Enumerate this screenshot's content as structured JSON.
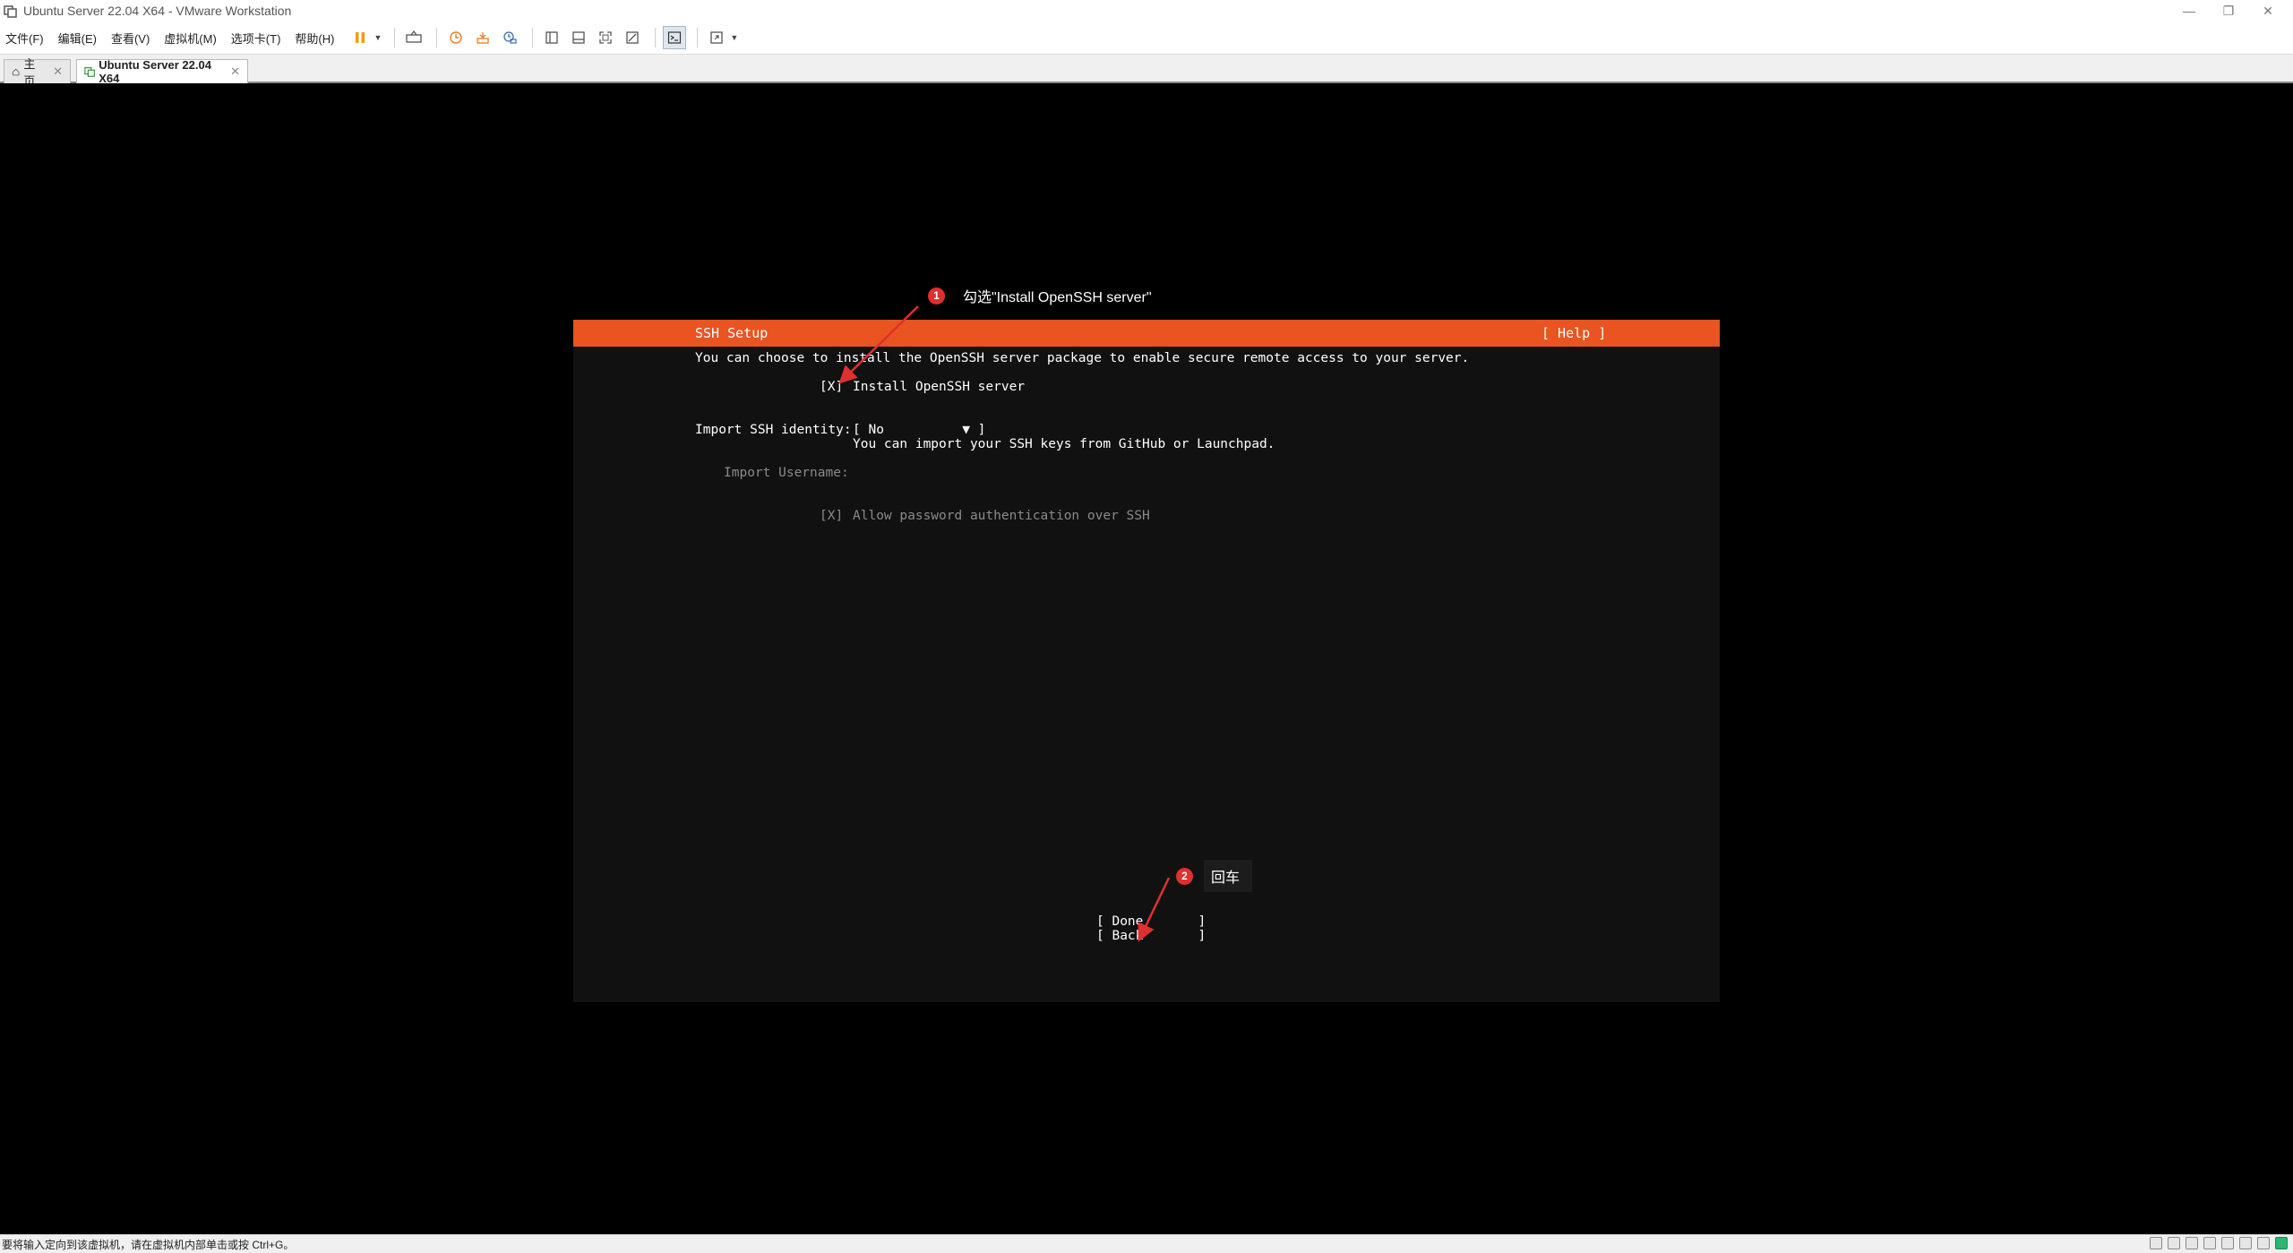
{
  "window": {
    "title": "Ubuntu Server 22.04 X64 - VMware Workstation",
    "minimize": "—",
    "restore": "❐",
    "close": "✕"
  },
  "menu": [
    "文件(F)",
    "编辑(E)",
    "查看(V)",
    "虚拟机(M)",
    "选项卡(T)",
    "帮助(H)"
  ],
  "tabs": [
    {
      "label": "主页",
      "close": "✕"
    },
    {
      "label": "Ubuntu Server 22.04 X64",
      "close": "✕"
    }
  ],
  "installer": {
    "header_title": "SSH Setup",
    "help": "[ Help ]",
    "intro": "You can choose to install the OpenSSH server package to enable secure remote access to your server.",
    "install_ssh_checkbox": "[X]",
    "install_ssh_label": "Install OpenSSH server",
    "import_identity_label": "Import SSH identity:",
    "import_identity_select": "[ No          ▼ ]",
    "import_identity_help": "You can import your SSH keys from GitHub or Launchpad.",
    "import_username_label": "Import Username:",
    "allow_password_checkbox": "[X]",
    "allow_password_label": "Allow password authentication over SSH",
    "done_button": "[ Done       ]",
    "back_button": "[ Back       ]"
  },
  "annotations": [
    {
      "number": "1",
      "text": "勾选\"Install OpenSSH server\""
    },
    {
      "number": "2",
      "text": "回车"
    }
  ],
  "status": {
    "message": "要将输入定向到该虚拟机，请在虚拟机内部单击或按 Ctrl+G。"
  },
  "colors": {
    "header_orange": "#e95420",
    "badge_red": "#e02f2f",
    "panel_bg": "#111111"
  }
}
